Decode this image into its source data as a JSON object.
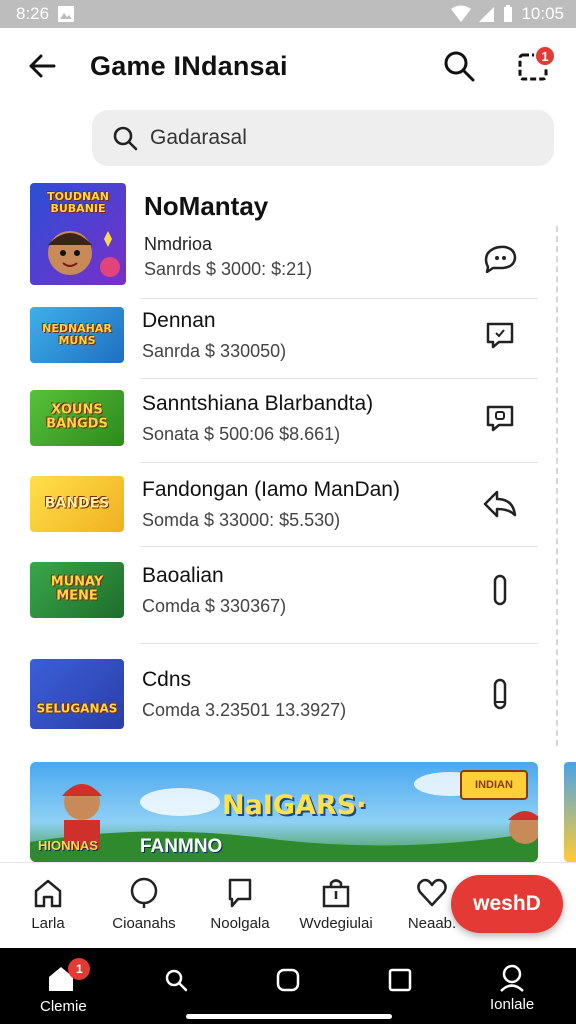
{
  "status_bar": {
    "time_left": "8:26",
    "time_right": "10:05"
  },
  "app_bar": {
    "title": "Game INdansai",
    "notification_count": "1"
  },
  "search": {
    "value": "Gadarasal",
    "placeholder": "Gadarasal"
  },
  "featured": {
    "title": "NoMantay",
    "subtitle": "Nmdrioa",
    "detail": "Sanrds $ 3000: $:21)",
    "thumb_text": "TOUDNAN BUBANIE",
    "action_icon": "chat-bubble-icon"
  },
  "games": [
    {
      "title": "Dennan",
      "detail": "Sanrda $ 330050)",
      "thumb_text": "NEDNAHAR MUNS",
      "action_icon": "message-icon"
    },
    {
      "title": "Sanntshiana Blarbandta)",
      "detail": "Sonata $ 500:06 $8.661)",
      "thumb_text": "XOUNS BANGDS",
      "action_icon": "message-icon"
    },
    {
      "title": "Fandongan (Iamo ManDan)",
      "detail": "Somda $ 33000: $5.530)",
      "thumb_text": "BANDES",
      "action_icon": "share-back-icon"
    },
    {
      "title": "Baoalian",
      "detail": "Comda $ 330367)",
      "thumb_text": "MUNAY MENE",
      "action_icon": "link-icon"
    },
    {
      "title": "Cdns",
      "detail": "Comda 3.23501 13.3927)",
      "thumb_text": "SELUGANAS",
      "action_icon": "link-icon"
    }
  ],
  "banner": {
    "title": "NaIGARS·",
    "subtitle": "FANMNO",
    "tag": "INDIAN",
    "left_tag": "HIONNAS"
  },
  "tabs": [
    {
      "label": "Larla",
      "icon": "home-icon"
    },
    {
      "label": "Cioanahs",
      "icon": "pin-icon"
    },
    {
      "label": "Noolgala",
      "icon": "chat-icon"
    },
    {
      "label": "Wvdegiulai",
      "icon": "bag-icon"
    },
    {
      "label": "Neaab.",
      "icon": "heart-icon"
    }
  ],
  "fab": {
    "label": "weshD"
  },
  "system_nav": {
    "left_label": "Clemie",
    "right_label": "Ionlale",
    "badge": "1"
  },
  "colors": {
    "accent": "#e53935",
    "search_bg": "#eeeeee"
  }
}
